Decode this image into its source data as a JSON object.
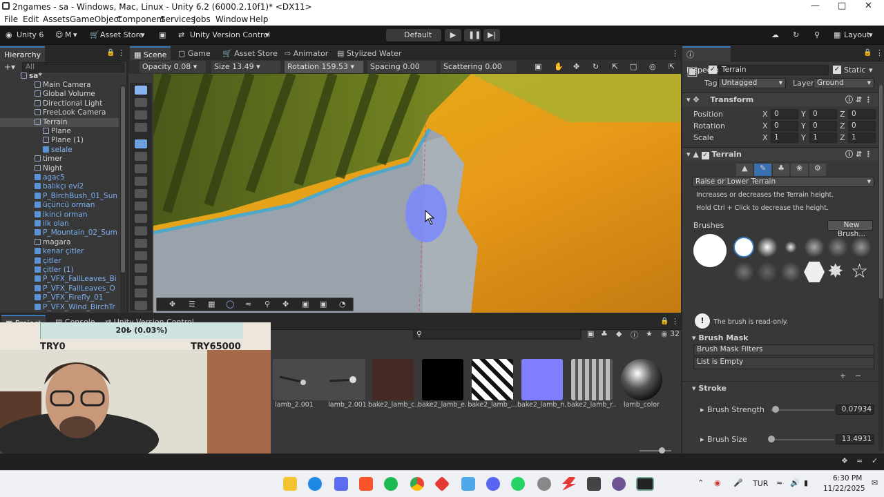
{
  "window": {
    "title": "2ngames - sa - Windows, Mac, Linux - Unity 6.2 (6000.2.10f1)* <DX11>"
  },
  "menu": [
    "File",
    "Edit",
    "Assets",
    "GameObject",
    "Component",
    "Services",
    "Jobs",
    "Window",
    "Help"
  ],
  "toolbar": {
    "unity": "Unity 6",
    "account": "M",
    "asset_store": "Asset Store",
    "version_control": "Unity Version Control",
    "layout_mode": "Default",
    "layout": "Layout"
  },
  "hierarchy": {
    "tab": "Hierarchy",
    "search_placeholder": "All",
    "scene": "sa*",
    "items": [
      {
        "label": "Main Camera",
        "indent": 1,
        "blue": false
      },
      {
        "label": "Global Volume",
        "indent": 1,
        "blue": false
      },
      {
        "label": "Directional Light",
        "indent": 1,
        "blue": false
      },
      {
        "label": "FreeLook Camera",
        "indent": 1,
        "blue": false
      },
      {
        "label": "Terrain",
        "indent": 1,
        "blue": false,
        "selected": true
      },
      {
        "label": "Plane",
        "indent": 2,
        "blue": false
      },
      {
        "label": "Plane (1)",
        "indent": 2,
        "blue": false
      },
      {
        "label": "selale",
        "indent": 2,
        "blue": true
      },
      {
        "label": "timer",
        "indent": 1,
        "blue": false
      },
      {
        "label": "Night",
        "indent": 1,
        "blue": false
      },
      {
        "label": "agac5",
        "indent": 1,
        "blue": true
      },
      {
        "label": "balıkçı evi2",
        "indent": 1,
        "blue": true
      },
      {
        "label": "P_BirchBush_01_Sun",
        "indent": 1,
        "blue": true
      },
      {
        "label": "üçüncü orman",
        "indent": 1,
        "blue": true
      },
      {
        "label": "ikinci orman",
        "indent": 1,
        "blue": true
      },
      {
        "label": "ilk olan",
        "indent": 1,
        "blue": true
      },
      {
        "label": "P_Mountain_02_Sum",
        "indent": 1,
        "blue": true
      },
      {
        "label": "magara",
        "indent": 1,
        "blue": false
      },
      {
        "label": "kenar çitler",
        "indent": 1,
        "blue": true
      },
      {
        "label": "çitler",
        "indent": 1,
        "blue": true
      },
      {
        "label": "çitler (1)",
        "indent": 1,
        "blue": true
      },
      {
        "label": "P_VFX_FallLeaves_Bi",
        "indent": 1,
        "blue": true
      },
      {
        "label": "P_VFX_FallLeaves_O",
        "indent": 1,
        "blue": true
      },
      {
        "label": "P_VFX_Firefly_01",
        "indent": 1,
        "blue": true
      },
      {
        "label": "P_VFX_Wind_BirchTr",
        "indent": 1,
        "blue": true
      }
    ]
  },
  "scene_tabs": [
    "Scene",
    "Game",
    "Asset Store",
    "Animator",
    "Stylized Water"
  ],
  "brush_bar": {
    "opacity": "Opacity 0.08",
    "size": "Size 13.49",
    "rotation": "Rotation 159.53",
    "spacing": "Spacing 0.00",
    "scattering": "Scattering 0.00"
  },
  "inspector": {
    "tab": "Inspector",
    "object_name": "Terrain",
    "static": "Static",
    "tag_label": "Tag",
    "tag": "Untagged",
    "layer_label": "Layer",
    "layer": "Ground",
    "transform": {
      "title": "Transform",
      "rows": [
        {
          "label": "Position",
          "x": "0",
          "y": "0",
          "z": "0"
        },
        {
          "label": "Rotation",
          "x": "0",
          "y": "0",
          "z": "0"
        },
        {
          "label": "Scale",
          "x": "1",
          "y": "1",
          "z": "1"
        }
      ]
    },
    "terrain": {
      "title": "Terrain",
      "mode": "Raise or Lower Terrain",
      "desc1": "Increases or decreases the Terrain height.",
      "desc2": "Hold Ctrl + Click to decrease the height."
    },
    "brushes_label": "Brushes",
    "new_brush": "New Brush...",
    "readonly_msg": "The brush is read-only.",
    "mask_title": "Brush Mask",
    "mask_filters": "Brush Mask Filters",
    "list_empty": "List is Empty",
    "stroke_title": "Stroke",
    "brush_strength_label": "Brush Strength",
    "brush_strength": "0.07934",
    "brush_size_label": "Brush Size",
    "brush_size": "13.4931"
  },
  "project": {
    "tabs": [
      "Project",
      "Console",
      "Unity Version Control"
    ],
    "count": "32",
    "assets": [
      "lamb_2.001",
      "lamb_2.001",
      "bake2_lamb_c...",
      "bake2_lamb_e...",
      "bake2_lamb_...",
      "bake2_lamb_n...",
      "bake2_lamb_r...",
      "lamb_color"
    ]
  },
  "overlay": {
    "progress": "20₺ (0.03%)",
    "progress_fraction": 0.0003,
    "left": "TRY0",
    "right": "TRY65000"
  },
  "taskbar": {
    "lang": "TUR",
    "time": "6:30 PM",
    "date": "11/22/2025"
  }
}
